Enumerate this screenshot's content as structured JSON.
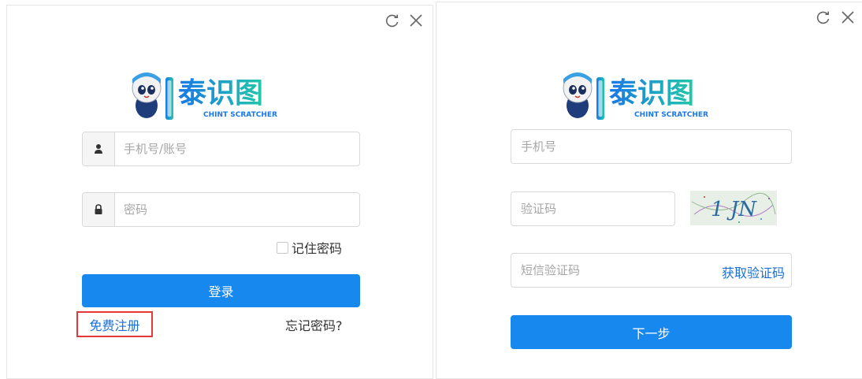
{
  "login": {
    "username_placeholder": "手机号/账号",
    "password_placeholder": "密码",
    "remember_label": "记住密码",
    "login_button": "登录",
    "register_link": "免费注册",
    "forgot_link": "忘记密码?"
  },
  "verify": {
    "phone_placeholder": "手机号",
    "captcha_placeholder": "验证码",
    "captcha_text": "1 JN",
    "sms_placeholder": "短信验证码",
    "get_code_label": "获取验证码",
    "next_button": "下一步"
  },
  "logo": {
    "title": "泰识图",
    "subtitle": "CHINT SCRATCHER"
  },
  "colors": {
    "primary": "#1688ee",
    "link": "#1a6fd6",
    "highlight": "#e53935",
    "logo_gradient_start": "#1a78e8",
    "logo_gradient_end": "#22c7a8"
  },
  "icons": [
    "refresh-icon",
    "close-icon",
    "user-icon",
    "lock-icon"
  ]
}
